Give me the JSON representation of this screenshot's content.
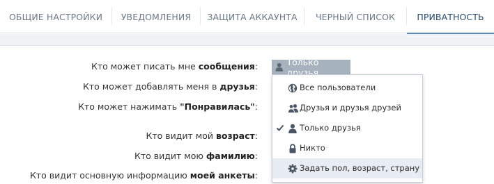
{
  "tabs": [
    {
      "label": "ОБЩИЕ НАСТРОЙКИ"
    },
    {
      "label": "УВЕДОМЛЕНИЯ"
    },
    {
      "label": "ЗАЩИТА АККАУНТА"
    },
    {
      "label": "ЧЕРНЫЙ СПИСОК"
    },
    {
      "label": "ПРИВАТНОСТЬ"
    }
  ],
  "rows": [
    {
      "prefix": "Кто может писать мне ",
      "bold": "сообщения",
      "suffix": ":"
    },
    {
      "prefix": "Кто может добавлять меня в ",
      "bold": "друзья",
      "suffix": ":"
    },
    {
      "prefix": "Кто может нажимать ",
      "bold": "\"Понравилась\"",
      "suffix": ":"
    },
    {
      "prefix": "Кто видит мой ",
      "bold": "возраст",
      "suffix": ":"
    },
    {
      "prefix": "Кто видит мою ",
      "bold": "фамилию",
      "suffix": ":"
    },
    {
      "prefix": "Кто видит основную информацию ",
      "bold": "моей анкеты",
      "suffix": ":"
    }
  ],
  "selected": {
    "label": "Только друзья"
  },
  "dropdown": {
    "items": [
      {
        "label": "Все пользователи",
        "icon": "globe-icon"
      },
      {
        "label": "Друзья и друзья друзей",
        "icon": "users-icon"
      },
      {
        "label": "Только друзья",
        "icon": "user-icon",
        "checked": true
      },
      {
        "label": "Никто",
        "icon": "lock-icon"
      },
      {
        "label": "Задать пол, возраст, страну",
        "icon": "gear-icon"
      }
    ]
  },
  "colors": {
    "accent": "#5b88b7",
    "selected_bg": "#a7b2bf",
    "hover_bg": "#e8edf3"
  }
}
